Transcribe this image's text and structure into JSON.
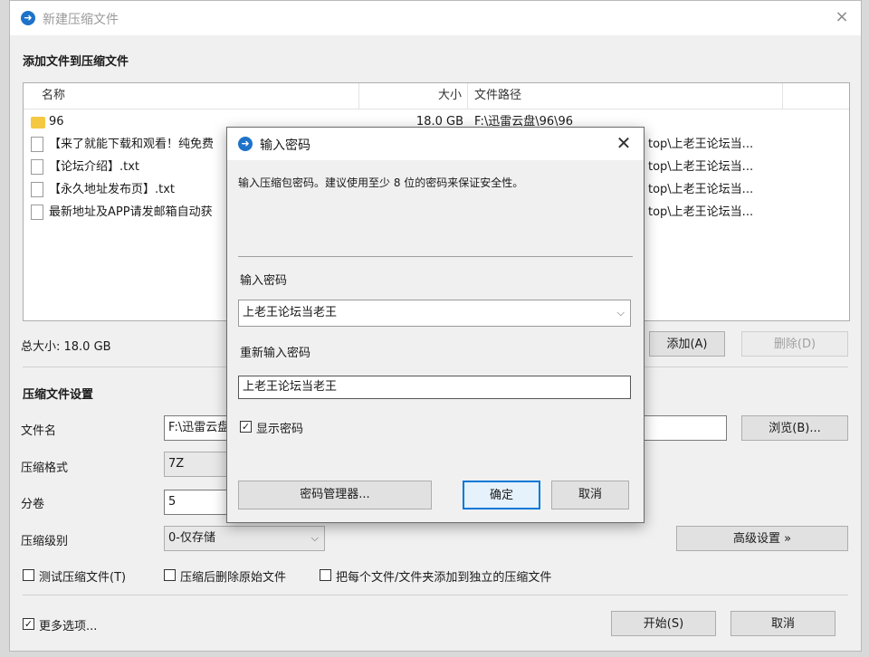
{
  "window": {
    "title": "新建压缩文件",
    "close_icon": "×"
  },
  "add_section": {
    "title": "添加文件到压缩文件",
    "columns": {
      "name": "名称",
      "size": "大小",
      "path": "文件路径"
    },
    "rows": [
      {
        "icon": "folder-icon",
        "name": "96",
        "size": "18.0 GB",
        "path": "F:\\迅雷云盘\\96\\96"
      },
      {
        "icon": "file-icon",
        "name": "【来了就能下载和观看！纯免费",
        "size": "",
        "path": "top\\上老王论坛当..."
      },
      {
        "icon": "file-icon",
        "name": "【论坛介绍】.txt",
        "size": "",
        "path": "top\\上老王论坛当..."
      },
      {
        "icon": "file-icon",
        "name": "【永久地址发布页】.txt",
        "size": "",
        "path": "top\\上老王论坛当..."
      },
      {
        "icon": "file-icon",
        "name": "最新地址及APP请发邮箱自动获",
        "size": "",
        "path": "top\\上老王论坛当..."
      }
    ],
    "total_size": "总大小: 18.0 GB",
    "add_button": "添加(A)",
    "delete_button": "删除(D)"
  },
  "settings": {
    "title": "压缩文件设置",
    "filename_label": "文件名",
    "filename_value": "F:\\迅雷云盘",
    "browse_button": "浏览(B)...",
    "format_label": "压缩格式",
    "format_value": "7Z",
    "split_label": "分卷",
    "split_value": "5",
    "level_label": "压缩级别",
    "level_value": "0-仅存储",
    "advanced_button": "高级设置 »",
    "test_checkbox": "测试压缩文件(T)",
    "delete_after_checkbox": "压缩后删除原始文件",
    "separate_checkbox": "把每个文件/文件夹添加到独立的压缩文件",
    "more_options": "更多选项...",
    "start_button": "开始(S)",
    "cancel_button": "取消"
  },
  "password_dialog": {
    "title": "输入密码",
    "description": "输入压缩包密码。建议使用至少 8 位的密码来保证安全性。",
    "password_label": "输入密码",
    "password_value": "上老王论坛当老王",
    "reenter_label": "重新输入密码",
    "reenter_value": "上老王论坛当老王",
    "show_password": "显示密码",
    "show_password_checked": true,
    "manager_button": "密码管理器...",
    "ok_button": "确定",
    "cancel_button": "取消"
  }
}
